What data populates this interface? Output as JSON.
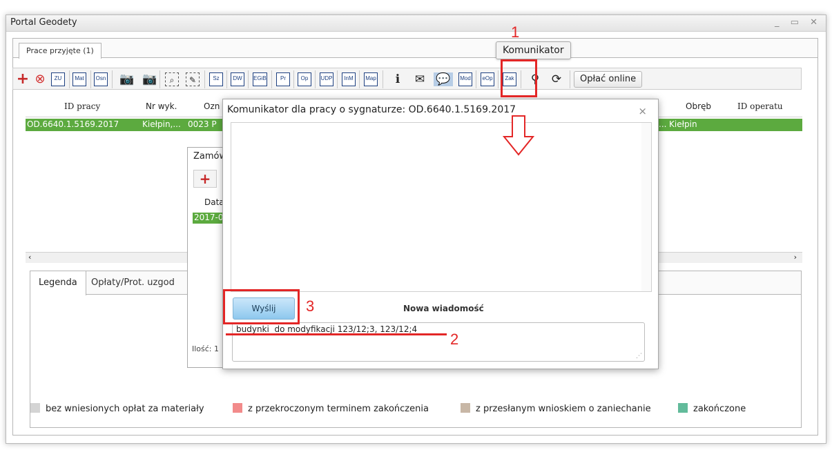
{
  "window": {
    "title": "Portal Geodety",
    "controls": "_ ▭ ✕"
  },
  "tabs": {
    "main": "Prace przyjęte (1)"
  },
  "toolbar": {
    "boxes": [
      "ZU",
      "Mat",
      "Osn",
      "Sz",
      "DW",
      "EGiB",
      "Pr",
      "Op",
      "UDP",
      "InM",
      "Map",
      "Mod",
      "eOp",
      "Zak"
    ],
    "pay_label": "Opłać online",
    "tooltip": "Komunikator"
  },
  "grid": {
    "headers": [
      "ID pracy",
      "Nr wyk.",
      "Ozn",
      "Obręb",
      "ID operatu"
    ],
    "row": {
      "id": "OD.6640.1.5169.2017",
      "nr": "Kiełpin,...",
      "ozn": "0023 P",
      "ellipsis": "...",
      "obreb": "Kiełpin"
    }
  },
  "bottom": {
    "tab_legend": "Legenda",
    "tab_fees": "Opłaty/Prot. uzgod",
    "legend": [
      {
        "label": "bez wniesionych opłat za materiały",
        "color": "#d4d4d4"
      },
      {
        "label": "z przekroczonym terminem zakończenia",
        "color": "#f28b8b"
      },
      {
        "label": "z przesłanym wnioskiem o zaniechanie",
        "color": "#c8b7a6"
      },
      {
        "label": "zakończone",
        "color": "#62bb9b"
      }
    ]
  },
  "order_dialog": {
    "title": "Zamów",
    "col": "Data",
    "row": "2017-0",
    "count": "Ilość: 1"
  },
  "chat": {
    "title": "Komunikator dla pracy o sygnaturze: OD.6640.1.5169.2017",
    "send_label": "Wyślij",
    "new_message_label": "Nowa wiadomość",
    "message_value": "budynki  do modyfikacji 123/12;3, 123/12;4"
  },
  "annotations": {
    "n1": "1",
    "n2": "2",
    "n3": "3",
    "color": "#e32626"
  }
}
